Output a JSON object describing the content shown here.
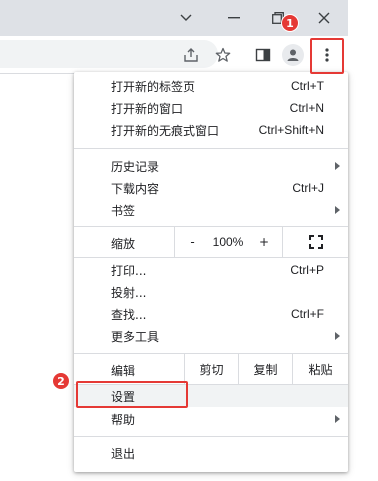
{
  "window": {
    "controls": [
      "chevron-down-icon",
      "minimize-icon",
      "restore-icon",
      "close-icon"
    ]
  },
  "toolbar": {
    "icons": [
      "share-icon",
      "star-icon",
      "side-panel-icon",
      "profile-icon",
      "more-vert-icon"
    ]
  },
  "annotations": {
    "badge1": "1",
    "badge2": "2",
    "accent": "#e53935"
  },
  "menu": {
    "new_tab": {
      "label": "打开新的标签页",
      "shortcut": "Ctrl+T"
    },
    "new_window": {
      "label": "打开新的窗口",
      "shortcut": "Ctrl+N"
    },
    "incognito": {
      "label": "打开新的无痕式窗口",
      "shortcut": "Ctrl+Shift+N"
    },
    "history": {
      "label": "历史记录"
    },
    "downloads": {
      "label": "下载内容",
      "shortcut": "Ctrl+J"
    },
    "bookmarks": {
      "label": "书签"
    },
    "zoom": {
      "label": "缩放",
      "minus": "-",
      "value": "100%",
      "plus": "+"
    },
    "print": {
      "label": "打印...",
      "shortcut": "Ctrl+P"
    },
    "cast": {
      "label": "投射..."
    },
    "find": {
      "label": "查找...",
      "shortcut": "Ctrl+F"
    },
    "more_tools": {
      "label": "更多工具"
    },
    "edit": {
      "label": "编辑",
      "cut": "剪切",
      "copy": "复制",
      "paste": "粘贴"
    },
    "settings": {
      "label": "设置"
    },
    "help": {
      "label": "帮助"
    },
    "exit": {
      "label": "退出"
    }
  }
}
